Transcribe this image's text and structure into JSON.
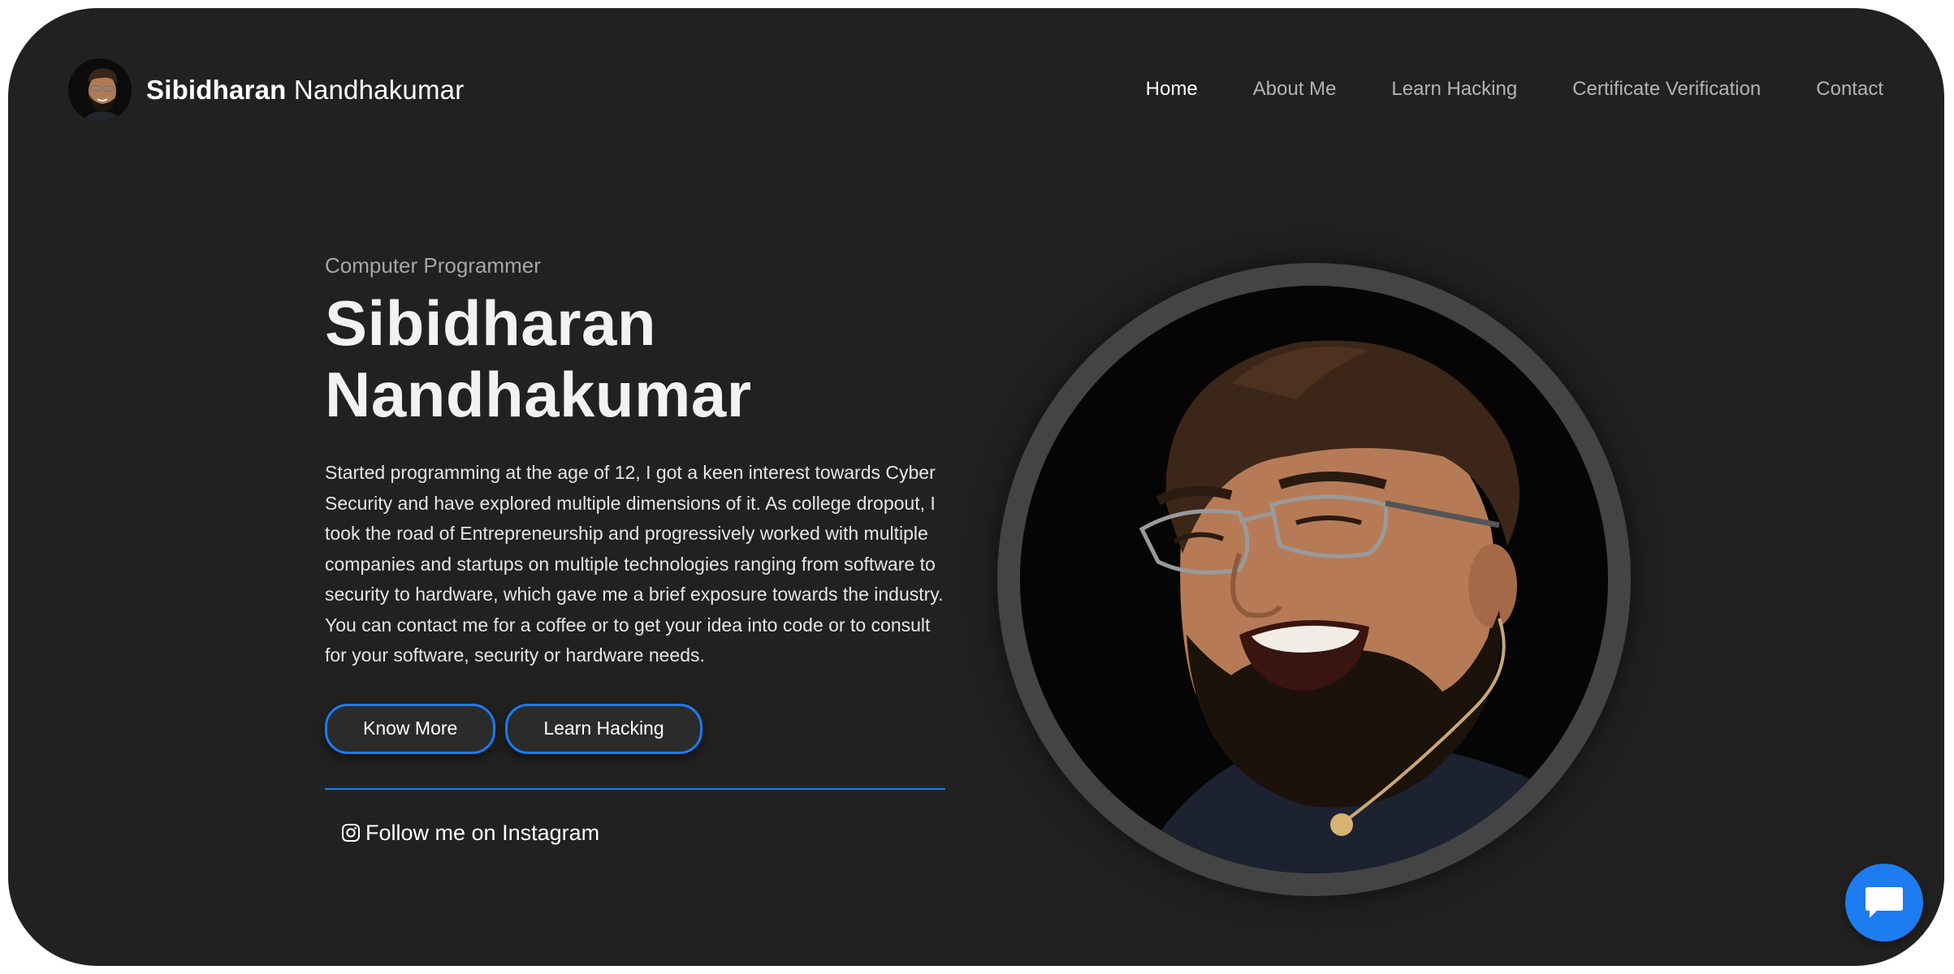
{
  "header": {
    "brand_first": "Sibidharan",
    "brand_last": "Nandhakumar",
    "nav": [
      {
        "label": "Home",
        "active": true
      },
      {
        "label": "About Me",
        "active": false
      },
      {
        "label": "Learn Hacking",
        "active": false
      },
      {
        "label": "Certificate Verification",
        "active": false
      },
      {
        "label": "Contact",
        "active": false
      }
    ]
  },
  "hero": {
    "subtitle": "Computer Programmer",
    "title_line1": "Sibidharan",
    "title_line2": "Nandhakumar",
    "bio": "Started programming at the age of 12, I got a keen interest towards Cyber Security and have explored multiple dimensions of it. As college dropout, I took the road of Entrepreneurship and progressively worked with multiple companies and startups on multiple technologies ranging from software to security to hardware, which gave me a brief exposure towards the industry. You can contact me for a coffee or to get your idea into code or to consult for your software, security or hardware needs.",
    "buttons": {
      "know_more": "Know More",
      "learn_hacking": "Learn Hacking"
    },
    "instagram_label": "Follow me on Instagram"
  },
  "icons": {
    "instagram": "instagram-icon",
    "chat": "chat-bubble-icon"
  },
  "colors": {
    "background": "#212121",
    "accent": "#1a7cf5",
    "chat_button": "#1d7cf0",
    "nav_inactive": "#b3b3b3",
    "nav_active": "#ffffff"
  }
}
